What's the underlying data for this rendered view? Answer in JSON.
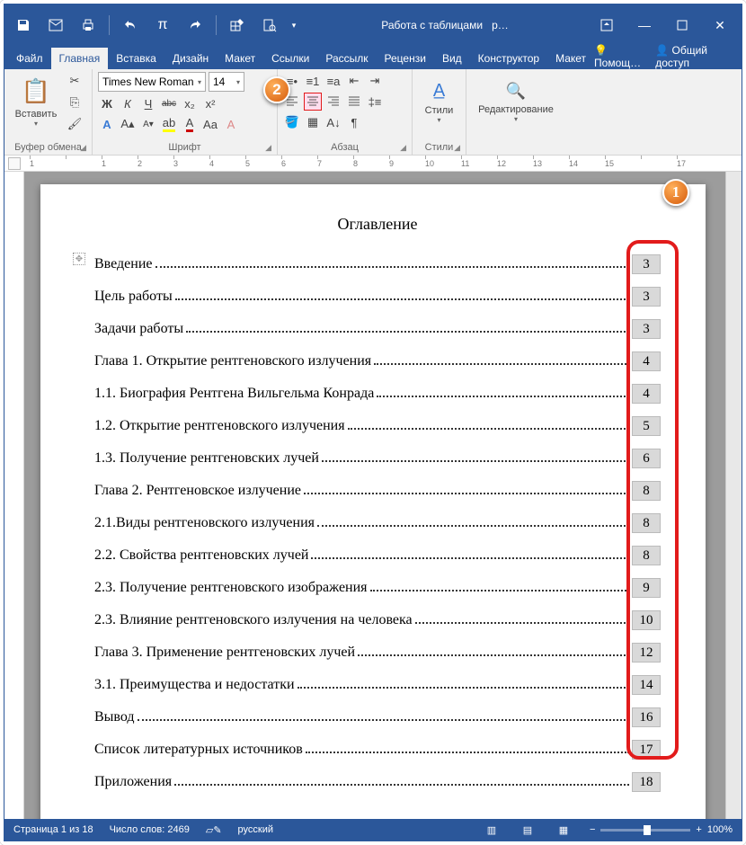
{
  "titlebar": {
    "context": "Работа с таблицами",
    "doc": "р…"
  },
  "tabs": {
    "file": "Файл",
    "home": "Главная",
    "insert": "Вставка",
    "design": "Дизайн",
    "layout": "Макет",
    "references": "Ссылки",
    "mailings": "Рассылк",
    "review": "Рецензи",
    "view": "Вид",
    "tblDesign": "Конструктор",
    "tblLayout": "Макет",
    "help": "Помощ…",
    "share": "Общий доступ"
  },
  "ribbon": {
    "clipboard": {
      "paste": "Вставить",
      "label": "Буфер обмена"
    },
    "font": {
      "name": "Times New Roman",
      "size": "14",
      "label": "Шрифт",
      "bold": "Ж",
      "italic": "К",
      "underline": "Ч",
      "strike": "abc",
      "sub": "x₂",
      "sup": "x²"
    },
    "paragraph": {
      "label": "Абзац"
    },
    "styles": {
      "btn": "Стили",
      "label": "Стили"
    },
    "editing": {
      "btn": "Редактирование"
    }
  },
  "callouts": {
    "one": "1",
    "two": "2"
  },
  "document": {
    "title": "Оглавление",
    "toc": [
      {
        "text": "Введение",
        "page": "3"
      },
      {
        "text": " Цель работы",
        "page": "3"
      },
      {
        "text": "Задачи работы",
        "page": "3"
      },
      {
        "text": "Глава 1. Открытие рентгеновского излучения",
        "page": "4"
      },
      {
        "text": "1.1. Биография Рентгена Вильгельма Конрада",
        "page": "4"
      },
      {
        "text": "1.2. Открытие рентгеновского излучения ",
        "page": "5"
      },
      {
        "text": "1.3. Получение рентгеновских лучей",
        "page": "6"
      },
      {
        "text": "Глава 2. Рентгеновское излучение",
        "page": "8"
      },
      {
        "text": "2.1.Виды рентгеновского излучения",
        "page": "8"
      },
      {
        "text": "2.2. Свойства рентгеновских лучей",
        "page": "8"
      },
      {
        "text": "2.3. Получение рентгеновского изображения",
        "page": "9"
      },
      {
        "text": "2.3. Влияние рентгеновского излучения на человека",
        "page": "10"
      },
      {
        "text": "Глава 3. Применение рентгеновских лучей",
        "page": "12"
      },
      {
        "text": "3.1. Преимущества и недостатки",
        "page": "14"
      },
      {
        "text": "Вывод",
        "page": "16"
      },
      {
        "text": "Список литературных источников",
        "page": "17"
      },
      {
        "text": "Приложения",
        "page": "18"
      }
    ]
  },
  "status": {
    "page": "Страница 1 из 18",
    "words": "Число слов: 2469",
    "lang": "русский",
    "zoom": "100%"
  },
  "ruler": [
    "1",
    "",
    "1",
    "2",
    "3",
    "4",
    "5",
    "6",
    "7",
    "8",
    "9",
    "10",
    "11",
    "12",
    "13",
    "14",
    "15",
    "",
    "17"
  ]
}
